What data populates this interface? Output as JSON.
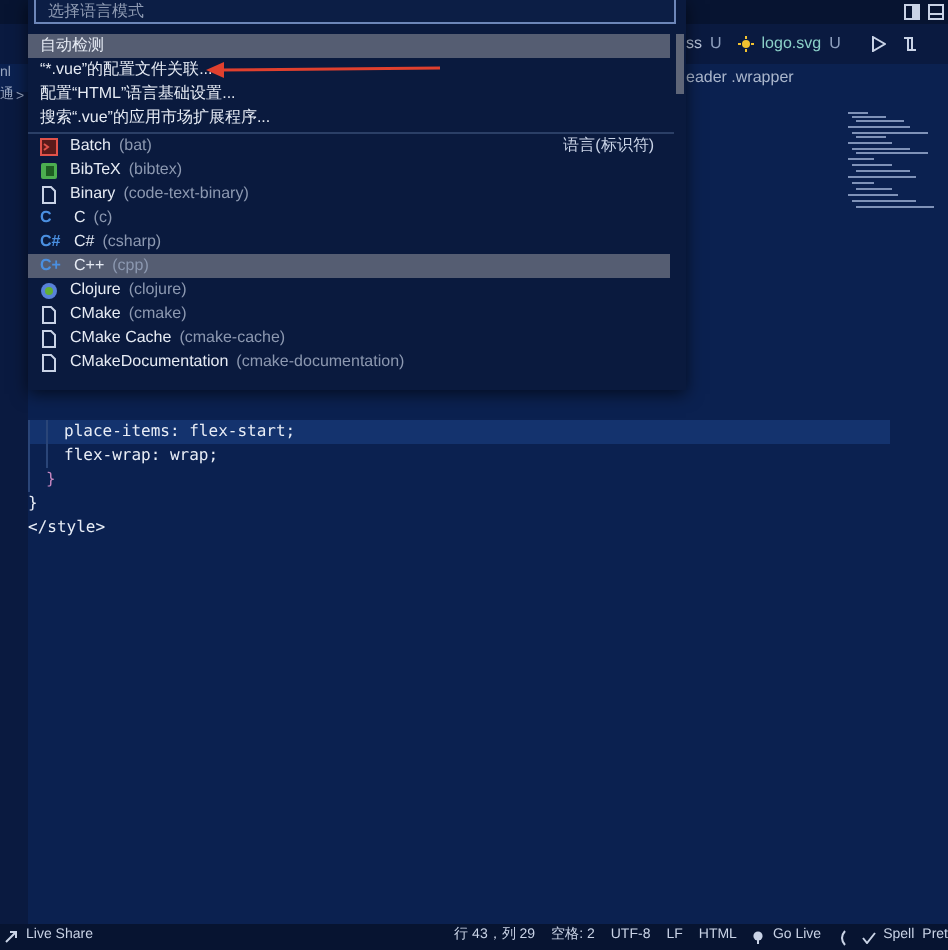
{
  "sidebar": {
    "items": [
      "nl",
      "通",
      ">"
    ]
  },
  "tabs": [
    {
      "label": "ss",
      "status": "U",
      "kind": "plain",
      "selected": false
    },
    {
      "label": "logo.svg",
      "status": "U",
      "kind": "svg",
      "selected": false
    }
  ],
  "breadcrumb": "eader .wrapper",
  "code_lines": [
    {
      "kind": "block",
      "children": [
        {
          "kind": "block",
          "children": [
            {
              "kind": "line",
              "text": "place-items: flex-start;",
              "current": true
            },
            {
              "kind": "line",
              "text": "flex-wrap: wrap;",
              "current": false
            }
          ]
        },
        {
          "kind": "line",
          "text": "}",
          "current": false
        }
      ]
    },
    {
      "kind": "line",
      "text": "}",
      "current": false
    },
    {
      "kind": "line",
      "text": "</style>",
      "current": false
    }
  ],
  "quick_pick": {
    "placeholder": "选择语言模式",
    "actions": [
      {
        "label": "自动检测",
        "selected": true
      },
      {
        "label": "“*.vue”的配置文件关联...",
        "selected": false
      },
      {
        "label": "配置“HTML”语言基础设置...",
        "selected": false
      },
      {
        "label": "搜索“.vue”的应用市场扩展程序...",
        "selected": false
      }
    ],
    "group_label": "语言(标识符)",
    "languages": [
      {
        "name": "Batch",
        "id": "(bat)",
        "kind": "terminal",
        "selected": false
      },
      {
        "name": "BibTeX",
        "id": "(bibtex)",
        "kind": "book",
        "selected": false
      },
      {
        "name": "Binary",
        "id": "(code-text-binary)",
        "kind": "file",
        "selected": false
      },
      {
        "name": "C",
        "id": "(c)",
        "kind": "glyph",
        "glyph": "C",
        "selected": false
      },
      {
        "name": "C#",
        "id": "(csharp)",
        "kind": "glyph",
        "glyph": "C#",
        "selected": false
      },
      {
        "name": "C++",
        "id": "(cpp)",
        "kind": "glyph",
        "glyph": "C+",
        "selected": true
      },
      {
        "name": "Clojure",
        "id": "(clojure)",
        "kind": "circle",
        "selected": false
      },
      {
        "name": "CMake",
        "id": "(cmake)",
        "kind": "file",
        "selected": false
      },
      {
        "name": "CMake Cache",
        "id": "(cmake-cache)",
        "kind": "file",
        "selected": false
      },
      {
        "name": "CMakeDocumentation",
        "id": "(cmake-documentation)",
        "kind": "file",
        "selected": false
      }
    ]
  },
  "status_bar": {
    "left": "Live Share",
    "items": [
      "行 43，列 29",
      "空格: 2",
      "UTF-8",
      "LF",
      "HTML"
    ],
    "go_live": "Go Live",
    "spell": "Spell",
    "last": "Pret"
  }
}
